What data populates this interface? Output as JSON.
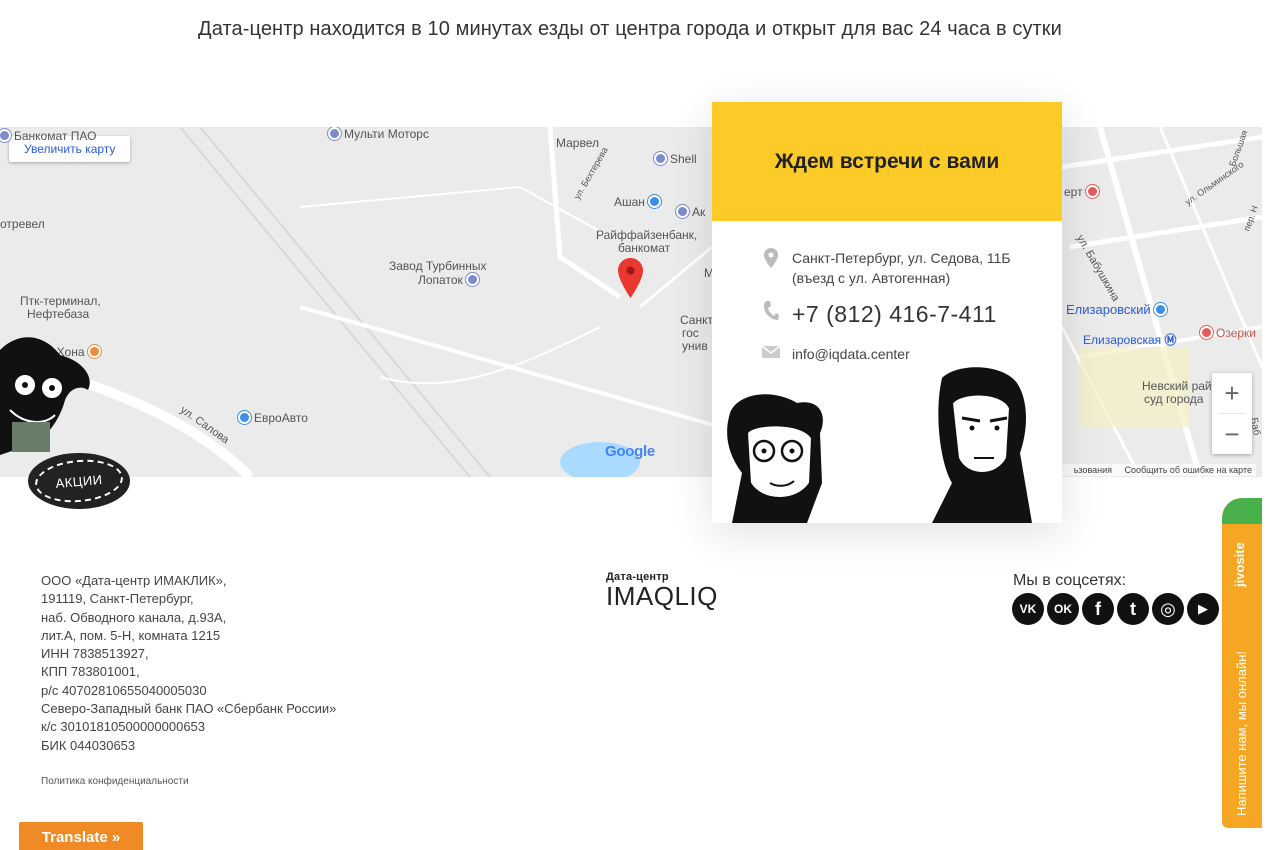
{
  "intro": {
    "subtitle": "Дата-центр находится в 10 минутах езды от центра города и открыт для вас 24 часа в сутки"
  },
  "map": {
    "enlarge_label": "Увеличить карту",
    "labels": [
      "Банкомат ПАО",
      "Мульти Моторс",
      "Марвел",
      "Shell",
      "Ашан",
      "Ак",
      "Райффайзенбанк,",
      "банкомат",
      "отревел",
      "Завод Турбинных",
      "Лопаток",
      "Птк-терминал,",
      "Нефтебаза",
      "са-Хона",
      "ЕвроАвто",
      "ул. Салова",
      "ул. Бехтерева",
      "Санкт",
      "гос",
      "унив",
      "М",
      "ерт",
      "ул. Бабушкина",
      "Елизаровский",
      "Елизаровская",
      "Озерки",
      "Невский рай",
      "суд города",
      "ул. Ольминского",
      "Большая",
      "пер. Н",
      "Баб"
    ],
    "google_logo": "Google",
    "footer_data": "ьзования",
    "footer_report": "Сообщить об ошибке на карте",
    "zoom_in": "+",
    "zoom_out": "−"
  },
  "contact_card": {
    "heading": "Ждем встречи с вами",
    "address_line1": "Санкт-Петербург, ул. Седова, 11Б",
    "address_line2": "(въезд с ул. Автогенная)",
    "phone": "+7 (812) 416-7-411",
    "email": "info@iqdata.center"
  },
  "promo": {
    "badge": "АКЦИИ"
  },
  "footer": {
    "company_lines": [
      "ООО «Дата-центр ИМАКЛИК»,",
      "191119, Санкт-Петербург,",
      "наб. Обводного канала, д.93А,",
      "лит.А, пом. 5-Н, комната 1215",
      "ИНН 7838513927,",
      "КПП 783801001,",
      "р/с 40702810655040005030",
      "Северо-Западный банк ПАО «Сбербанк России»",
      "к/с 30101810500000000653",
      "БИК 044030653"
    ],
    "policy_link": "Политика конфиденциальности",
    "logo_small": "Дата-центр",
    "logo_big": "IMAQLIQ",
    "social_title": "Мы в соцсетях:",
    "social": [
      "vk-icon",
      "ok-icon",
      "facebook-icon",
      "twitter-icon",
      "instagram-icon",
      "youtube-icon"
    ],
    "social_glyphs": [
      "VK",
      "OK",
      "f",
      "t",
      "◎",
      "▶"
    ]
  },
  "translate": {
    "label": "Translate »"
  },
  "jivo": {
    "brand": "jivosite",
    "text": "Напишите нам, мы онлайн!"
  },
  "colors": {
    "accent_yellow": "#fccb27",
    "translate_orange": "#f08a24",
    "jivo_orange": "#f5a623",
    "jivo_green": "#48b14b",
    "map_bg": "#ebebeb"
  }
}
